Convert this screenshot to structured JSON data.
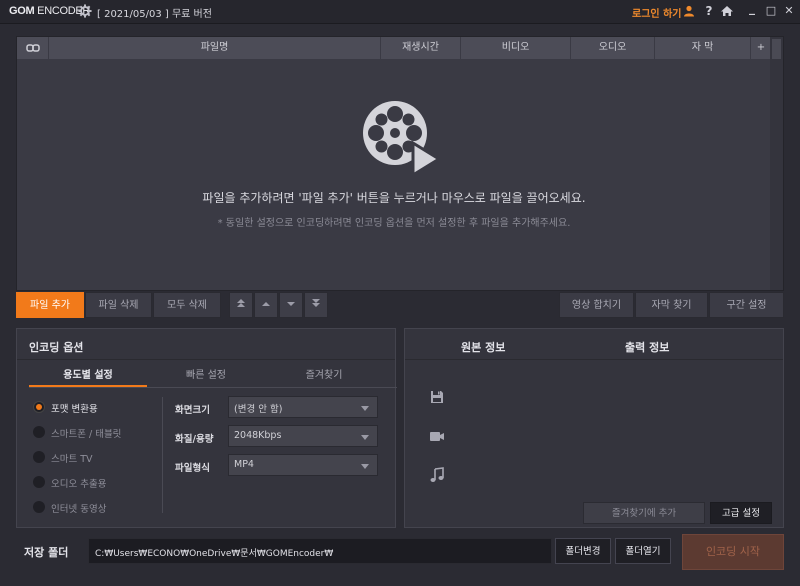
{
  "titlebar": {
    "logo_bold": "GOM",
    "logo_light": "ENCODER",
    "version": "[ 2021/05/03 ] 무료 버전",
    "login": "로그인 하기",
    "help": "?",
    "min": "_",
    "max": "□",
    "close": "✕"
  },
  "table": {
    "link_col": "link-icon",
    "columns": [
      "파일명",
      "재생시간",
      "비디오",
      "오디오",
      "자 막",
      "+"
    ]
  },
  "empty": {
    "hint": "파일을 추가하려면 '파일 추가' 버튼을 누르거나 마우스로 파일을 끌어오세요.",
    "subhint": "* 동일한 설정으로 인코딩하려면 인코딩 옵션을 먼저 설정한 후 파일을 추가해주세요."
  },
  "file_toolbar": {
    "add": "파일 추가",
    "delete": "파일 삭제",
    "delete_all": "모두 삭제",
    "preview": "영상 합치기",
    "subtitle_find": "자막 찾기",
    "section": "구간 설정"
  },
  "encoding": {
    "title": "인코딩 옵션",
    "tabs": [
      "용도별 설정",
      "빠른 설정",
      "즐겨찾기"
    ],
    "purposes": [
      "포맷 변환용",
      "스마트폰 / 태블릿",
      "스마트 TV",
      "오디오 추출용",
      "인터넷 동영상"
    ],
    "fields": [
      {
        "label": "화면크기",
        "value": "(변경 안 함)"
      },
      {
        "label": "화질/용량",
        "value": "2048Kbps"
      },
      {
        "label": "파일형식",
        "value": "MP4"
      }
    ]
  },
  "info": {
    "source": "원본 정보",
    "output": "출력 정보",
    "fav_add": "즐겨찾기에 추가",
    "advanced": "고급 설정"
  },
  "save": {
    "label": "저장 폴더",
    "path": "C:₩Users₩ECONO₩OneDrive₩문서₩GOMEncoder₩",
    "change": "폴더변경",
    "open": "폴더열기",
    "start": "인코딩 시작"
  },
  "colors": {
    "accent": "#f27a1a",
    "background": "#2b2b33"
  }
}
